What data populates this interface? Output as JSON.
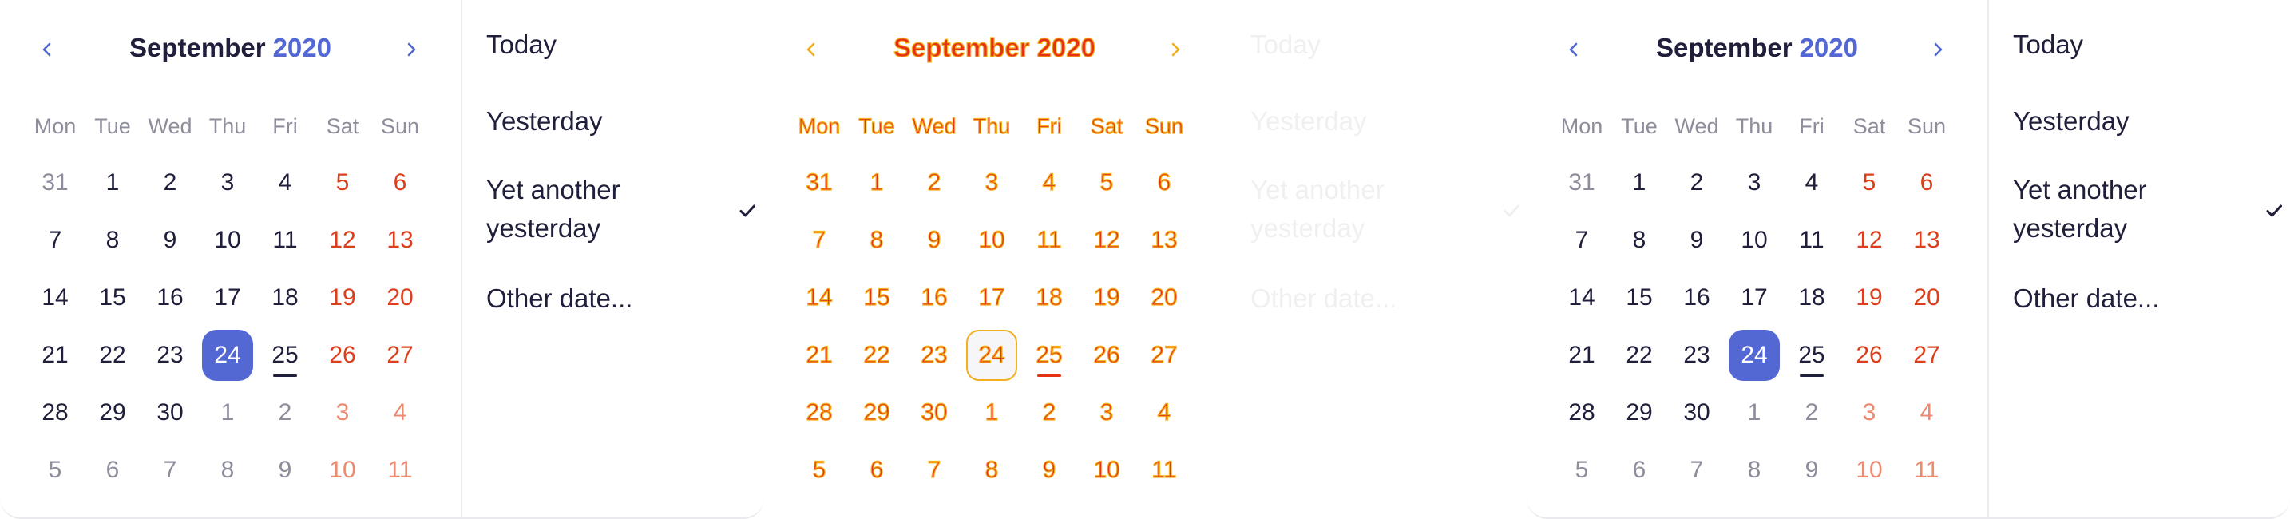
{
  "panels": [
    {
      "id": "left",
      "variant": "normal"
    },
    {
      "id": "middle",
      "variant": "ghost"
    },
    {
      "id": "right",
      "variant": "normal"
    }
  ],
  "calendar": {
    "month": "September",
    "year": "2020",
    "weekdays": [
      "Mon",
      "Tue",
      "Wed",
      "Thu",
      "Fri",
      "Sat",
      "Sun"
    ],
    "weeks": [
      [
        {
          "d": "31",
          "t": "out"
        },
        {
          "d": "1",
          "t": "in"
        },
        {
          "d": "2",
          "t": "in"
        },
        {
          "d": "3",
          "t": "in"
        },
        {
          "d": "4",
          "t": "in"
        },
        {
          "d": "5",
          "t": "we"
        },
        {
          "d": "6",
          "t": "we"
        }
      ],
      [
        {
          "d": "7",
          "t": "in"
        },
        {
          "d": "8",
          "t": "in"
        },
        {
          "d": "9",
          "t": "in"
        },
        {
          "d": "10",
          "t": "in"
        },
        {
          "d": "11",
          "t": "in"
        },
        {
          "d": "12",
          "t": "we"
        },
        {
          "d": "13",
          "t": "we"
        }
      ],
      [
        {
          "d": "14",
          "t": "in"
        },
        {
          "d": "15",
          "t": "in"
        },
        {
          "d": "16",
          "t": "in"
        },
        {
          "d": "17",
          "t": "in"
        },
        {
          "d": "18",
          "t": "in"
        },
        {
          "d": "19",
          "t": "we"
        },
        {
          "d": "20",
          "t": "we"
        }
      ],
      [
        {
          "d": "21",
          "t": "in"
        },
        {
          "d": "22",
          "t": "in"
        },
        {
          "d": "23",
          "t": "in"
        },
        {
          "d": "24",
          "t": "sel"
        },
        {
          "d": "25",
          "t": "today"
        },
        {
          "d": "26",
          "t": "we"
        },
        {
          "d": "27",
          "t": "we"
        }
      ],
      [
        {
          "d": "28",
          "t": "in"
        },
        {
          "d": "29",
          "t": "in"
        },
        {
          "d": "30",
          "t": "in"
        },
        {
          "d": "1",
          "t": "out"
        },
        {
          "d": "2",
          "t": "out"
        },
        {
          "d": "3",
          "t": "outwe"
        },
        {
          "d": "4",
          "t": "outwe"
        }
      ],
      [
        {
          "d": "5",
          "t": "out"
        },
        {
          "d": "6",
          "t": "out"
        },
        {
          "d": "7",
          "t": "out"
        },
        {
          "d": "8",
          "t": "out"
        },
        {
          "d": "9",
          "t": "out"
        },
        {
          "d": "10",
          "t": "outwe"
        },
        {
          "d": "11",
          "t": "outwe"
        }
      ]
    ],
    "prev_icon": "chevron-left-icon",
    "next_icon": "chevron-right-icon"
  },
  "menu": {
    "items": [
      {
        "label": "Today",
        "lines": [
          "Today"
        ],
        "checked": false
      },
      {
        "label": "Yesterday",
        "lines": [
          "Yesterday"
        ],
        "checked": false
      },
      {
        "label": "Yet another yesterday",
        "lines": [
          "Yet another",
          "yesterday"
        ],
        "checked": true
      },
      {
        "label": "Other date...",
        "lines": [
          "Other date..."
        ],
        "checked": false
      }
    ],
    "check_icon": "checkmark-icon"
  },
  "colors": {
    "text": "#1f1f3b",
    "accent": "#5468d4",
    "weekend": "#dc3f1c",
    "weekend_out": "#ed8a70",
    "muted": "#8d8d9c",
    "selected_bg": "#5468d4",
    "selected_text": "#ffffff",
    "divider": "#ebebf0",
    "ghost_text": "#f0f0f2",
    "ghost_outline": "#f2b020",
    "ghost_fill": "#e43212"
  }
}
